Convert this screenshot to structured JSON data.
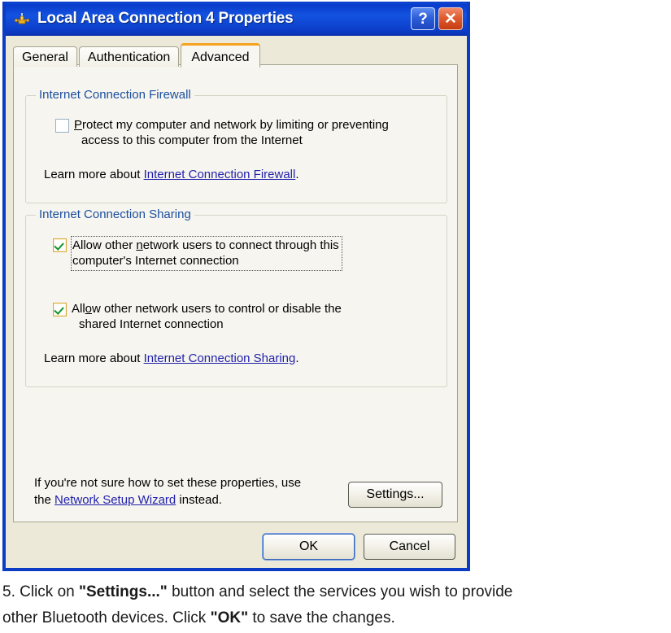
{
  "window": {
    "title": "Local Area Connection 4 Properties",
    "icon": "network-connection-icon",
    "help_button_label": "?",
    "close_button_label": "✕",
    "accent_titlebar_color": "#0a3cc4",
    "active_tab_accent_color": "#f5a21e"
  },
  "tabs": [
    {
      "label": "General",
      "active": false
    },
    {
      "label": "Authentication",
      "active": false
    },
    {
      "label": "Advanced",
      "active": true
    }
  ],
  "firewall_group": {
    "title": "Internet Connection Firewall",
    "checkbox": {
      "checked": false,
      "line1_before": "",
      "accesskey": "P",
      "line1_after": "rotect my computer and network by limiting or preventing",
      "line2": "access to this computer from the Internet"
    },
    "learn_more_prefix": "Learn more about ",
    "learn_more_link": "Internet Connection Firewall",
    "learn_more_suffix": "."
  },
  "sharing_group": {
    "title": "Internet Connection Sharing",
    "checkbox1": {
      "checked": true,
      "focused": true,
      "line1_before": "Allow other ",
      "accesskey": "n",
      "line1_after": "etwork users to connect through this",
      "line2": "computer's Internet connection"
    },
    "checkbox2": {
      "checked": true,
      "focused": false,
      "line1_before": "All",
      "accesskey": "o",
      "line1_after": "w other network users to control or disable the",
      "line2": "shared Internet connection"
    },
    "learn_more_prefix": "Learn more about ",
    "learn_more_link": "Internet Connection Sharing",
    "learn_more_suffix": "."
  },
  "hint": {
    "line1": "If you're not sure how to set these properties, use",
    "line2_prefix": "the ",
    "line2_link": "Network Setup Wizard",
    "line2_suffix": " instead."
  },
  "buttons": {
    "settings": "Settings...",
    "ok": "OK",
    "cancel": "Cancel"
  },
  "caption": {
    "step_number": "5. ",
    "text1": "Click on ",
    "bold1": "\"Settings...\"",
    "text2": " button and select the services you wish to provide",
    "text3": "other Bluetooth devices. Click ",
    "bold2": "\"OK\"",
    "text4": " to save the changes."
  }
}
